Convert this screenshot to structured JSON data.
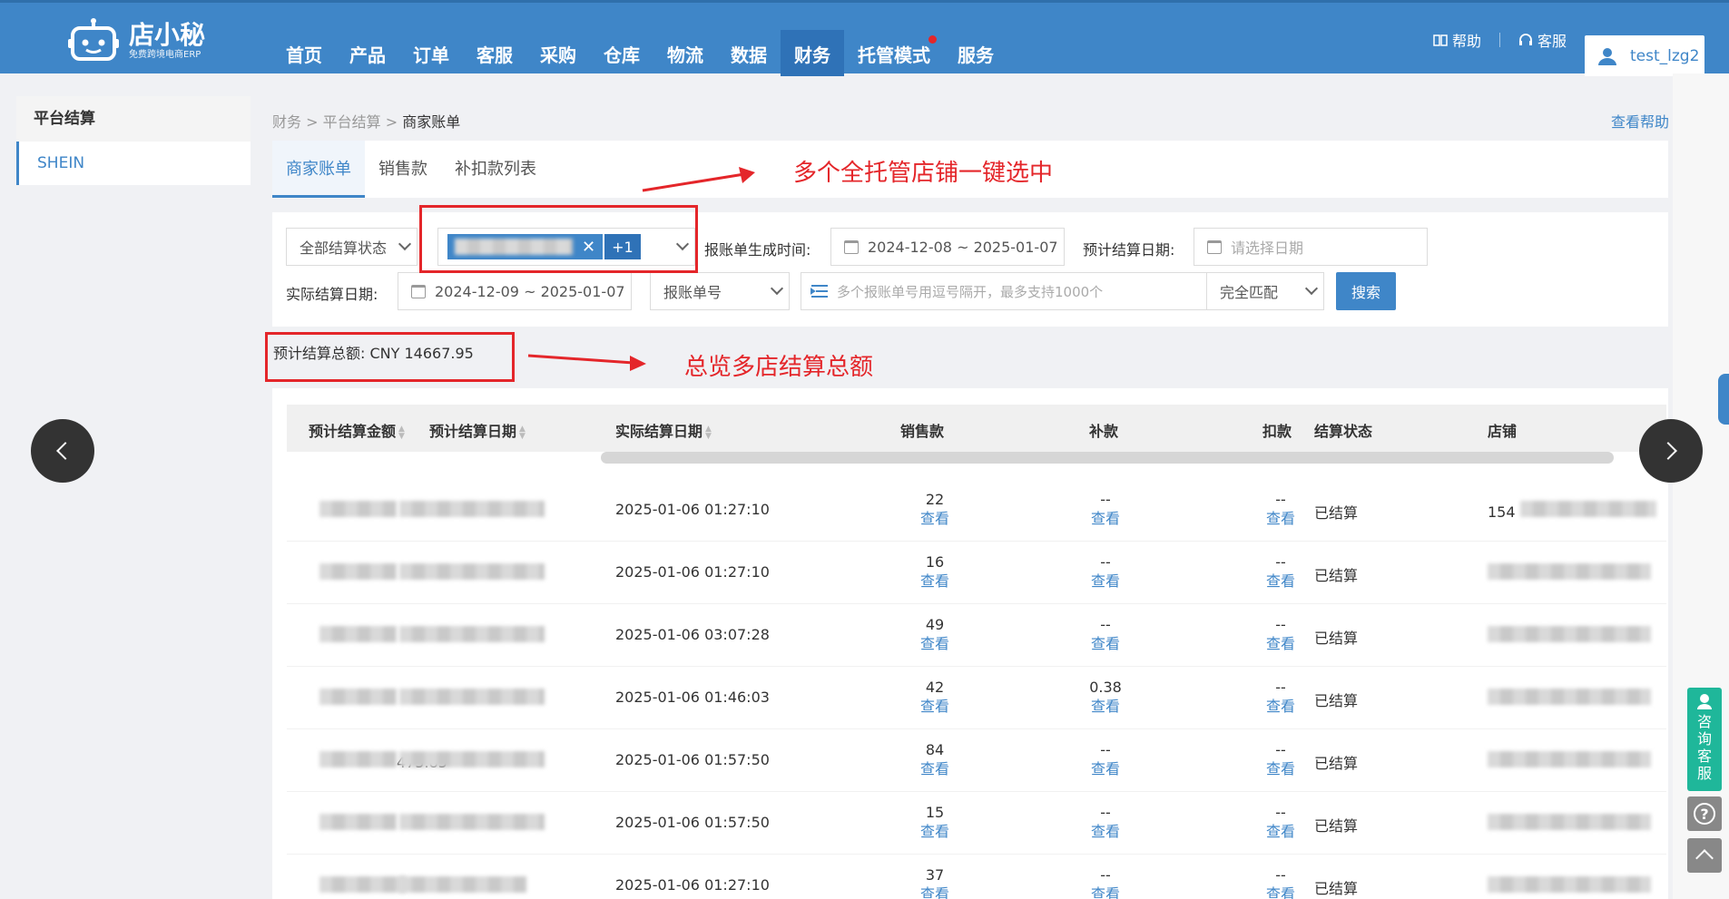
{
  "logo": {
    "title": "店小秘",
    "subtitle": "免费跨境电商ERP"
  },
  "nav": {
    "items": [
      {
        "label": "首页"
      },
      {
        "label": "产品"
      },
      {
        "label": "订单"
      },
      {
        "label": "客服"
      },
      {
        "label": "采购"
      },
      {
        "label": "仓库"
      },
      {
        "label": "物流"
      },
      {
        "label": "数据"
      },
      {
        "label": "财务",
        "active": true
      },
      {
        "label": "托管模式",
        "dot": true
      },
      {
        "label": "服务"
      }
    ],
    "help": "帮助",
    "service": "客服",
    "user": "test_lzg2"
  },
  "sidebar": {
    "header": "平台结算",
    "items": [
      {
        "label": "SHEIN"
      }
    ]
  },
  "breadcrumb": {
    "l1": "财务",
    "l2": "平台结算",
    "l3": "商家账单"
  },
  "help_link": "查看帮助",
  "tabs": [
    {
      "label": "商家账单"
    },
    {
      "label": "销售款"
    },
    {
      "label": "补扣款列表"
    }
  ],
  "filters": {
    "status_select": "全部结算状态",
    "store_extra": "+1",
    "bill_time_label": "报账单生成时间:",
    "bill_time_value": "2024-12-08 ~ 2025-01-07",
    "expected_date_label": "预计结算日期:",
    "expected_date_placeholder": "请选择日期",
    "actual_date_label": "实际结算日期:",
    "actual_date_value": "2024-12-09 ~ 2025-01-07",
    "bill_no_select": "报账单号",
    "bill_no_placeholder": "多个报账单号用逗号隔开，最多支持1000个",
    "match_select": "完全匹配",
    "search_button": "搜索"
  },
  "total": {
    "label": "预计结算总额:",
    "value": "CNY 14667.95"
  },
  "table": {
    "columns": {
      "amount": "预计结算金额",
      "expected_date": "预计结算日期",
      "actual_date": "实际结算日期",
      "sales": "销售款",
      "refill": "补款",
      "deduct": "扣款",
      "status": "结算状态",
      "store": "店铺"
    },
    "view_label": "查看",
    "rows": [
      {
        "actual": "2025-01-06 01:27:10",
        "sales": "22",
        "refill": "--",
        "deduct": "--",
        "status": "已结算",
        "store_prefix": "154"
      },
      {
        "actual": "2025-01-06 01:27:10",
        "sales": "16",
        "refill": "--",
        "deduct": "--",
        "status": "已结算",
        "store_prefix": ""
      },
      {
        "actual": "2025-01-06 03:07:28",
        "sales": "49",
        "refill": "--",
        "deduct": "--",
        "status": "已结算",
        "store_prefix": ""
      },
      {
        "actual": "2025-01-06 01:46:03",
        "sales": "42",
        "refill": "0.38",
        "deduct": "--",
        "status": "已结算",
        "store_prefix": ""
      },
      {
        "actual": "2025-01-06 01:57:50",
        "sales": "84",
        "refill": "--",
        "deduct": "--",
        "status": "已结算",
        "store_prefix": "",
        "amount_tail": "475.85"
      },
      {
        "actual": "2025-01-06 01:57:50",
        "sales": "15",
        "refill": "--",
        "deduct": "--",
        "status": "已结算",
        "store_prefix": ""
      },
      {
        "actual": "2025-01-06 01:27:10",
        "sales": "37",
        "refill": "--",
        "deduct": "--",
        "status": "已结算",
        "store_prefix": ""
      }
    ]
  },
  "annotations": {
    "store_select": "多个全托管店铺一键选中",
    "total": "总览多店结算总额"
  },
  "consult": "咨询客服",
  "colors": {
    "primary": "#3f86c8",
    "annotation": "#e4262a",
    "consult": "#1fb79a"
  }
}
